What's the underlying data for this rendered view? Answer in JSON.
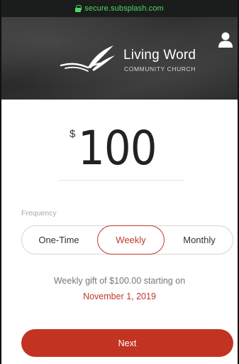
{
  "browser": {
    "url": "secure.subsplash.com"
  },
  "header": {
    "org_name": "Living Word",
    "org_sub": "COMMUNITY CHURCH"
  },
  "amount": {
    "currency_symbol": "$",
    "value": "100"
  },
  "frequency": {
    "label": "Frequency",
    "options": [
      {
        "label": "One-Time",
        "selected": false
      },
      {
        "label": "Weekly",
        "selected": true
      },
      {
        "label": "Monthly",
        "selected": false
      }
    ]
  },
  "summary": {
    "text": "Weekly gift of $100.00 starting on",
    "date": "November 1, 2019"
  },
  "actions": {
    "next_label": "Next"
  },
  "colors": {
    "accent": "#c0392b",
    "button": "#c23321",
    "url_green": "#4cd964"
  }
}
